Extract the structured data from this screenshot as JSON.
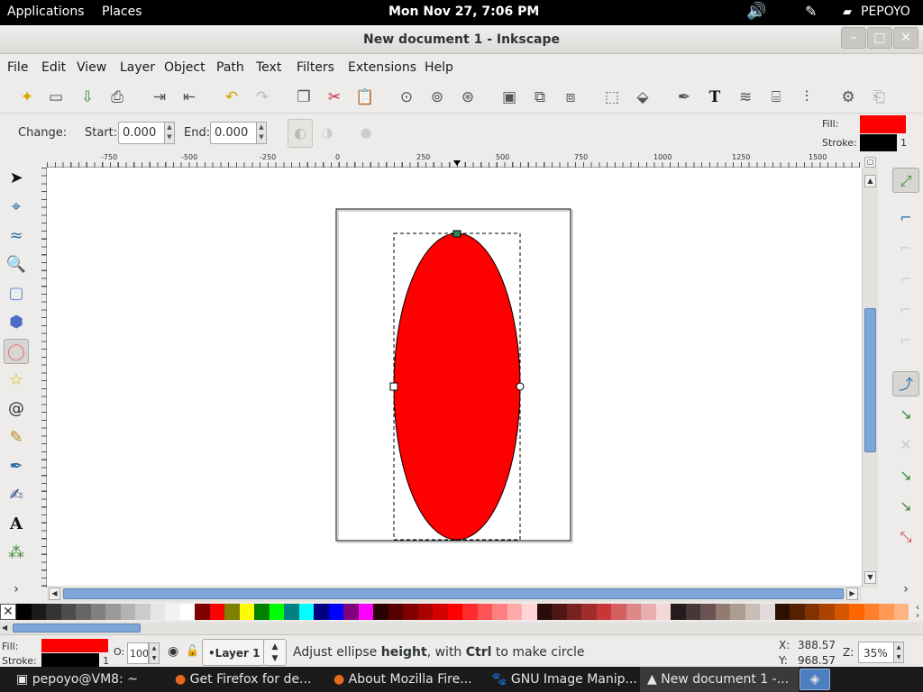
{
  "topbar": {
    "applications": "Applications",
    "places": "Places",
    "datetime": "Mon Nov 27,  7:06 PM",
    "user": "PEPOYO"
  },
  "window": {
    "title": "New document 1 - Inkscape",
    "minimize": "–",
    "maximize": "□",
    "close": "✕"
  },
  "menu": [
    "File",
    "Edit",
    "View",
    "Layer",
    "Object",
    "Path",
    "Text",
    "Filters",
    "Extensions",
    "Help"
  ],
  "commands": [
    "new-icon",
    "open-icon",
    "import-icon",
    "print-icon",
    "import-doc-icon",
    "export-icon",
    "undo-icon",
    "redo-icon",
    "duplicate-icon",
    "cut-icon",
    "paste-icon",
    "zoom-selection-icon",
    "zoom-drawing-icon",
    "zoom-page-icon",
    "group-icon",
    "clone-icon",
    "unlink-clone-icon",
    "ungroup-icon",
    "select-same-icon",
    "xml-editor-icon",
    "fill-stroke-icon",
    "text-tool-icon",
    "layers-icon",
    "xml-icon",
    "align-icon",
    "preferences-icon",
    "document-properties-icon"
  ],
  "ctrl": {
    "change": "Change:",
    "start_label": "Start:",
    "start_value": "0.000",
    "end_label": "End:",
    "end_value": "0.000"
  },
  "style": {
    "fill_label": "Fill:",
    "stroke_label": "Stroke:",
    "stroke_width": "1",
    "fill_color": "#ff0000",
    "stroke_color": "#000000"
  },
  "ruler": {
    "ticks": [
      "-750",
      "-500",
      "-250",
      "0",
      "250",
      "500",
      "750",
      "1000",
      "1250",
      "1500"
    ]
  },
  "status": {
    "fill_label": "Fill:",
    "stroke_label": "Stroke:",
    "stroke_width": "1",
    "opacity_label": "O:",
    "opacity_value": "100",
    "layer": "•Layer 1",
    "message_pre": "Adjust ellipse ",
    "message_bold1": "height",
    "message_mid": ", with ",
    "message_bold2": "Ctrl",
    "message_post": " to make circle",
    "x_label": "X:",
    "x_value": "388.57",
    "y_label": "Y:",
    "y_value": "968.57",
    "zoom_label": "Z:",
    "zoom_value": "35%"
  },
  "taskbar": [
    {
      "label": "pepoyo@VM8: ~",
      "icon": "terminal-icon"
    },
    {
      "label": "Get Firefox for de...",
      "icon": "firefox-icon"
    },
    {
      "label": "About Mozilla Fire...",
      "icon": "firefox-icon"
    },
    {
      "label": "GNU Image Manip...",
      "icon": "gimp-icon"
    },
    {
      "label": "New document 1 -...",
      "icon": "inkscape-icon"
    }
  ],
  "palette": [
    "#000000",
    "#1a1a1a",
    "#333333",
    "#4d4d4d",
    "#666666",
    "#808080",
    "#999999",
    "#b3b3b3",
    "#cccccc",
    "#e6e6e6",
    "#f2f2f2",
    "#ffffff",
    "#800000",
    "#ff0000",
    "#808000",
    "#ffff00",
    "#008000",
    "#00ff00",
    "#008080",
    "#00ffff",
    "#000080",
    "#0000ff",
    "#800080",
    "#ff00ff",
    "#2b0000",
    "#550000",
    "#800000",
    "#aa0000",
    "#d40000",
    "#ff0000",
    "#ff2a2a",
    "#ff5555",
    "#ff8080",
    "#ffaaaa",
    "#ffd5d5",
    "#280b0b",
    "#501616",
    "#782121",
    "#a02c2c",
    "#c83737",
    "#d35f5f",
    "#de8787",
    "#e9afaf",
    "#f4d7d7",
    "#241c1c",
    "#483737",
    "#6c5353",
    "#917c6f",
    "#ac9d93",
    "#c8beb7",
    "#e3dbdb",
    "#2b1100",
    "#552200",
    "#803300",
    "#aa4400",
    "#d45500",
    "#ff6600",
    "#ff7f2a",
    "#ff9955",
    "#ffb380"
  ]
}
